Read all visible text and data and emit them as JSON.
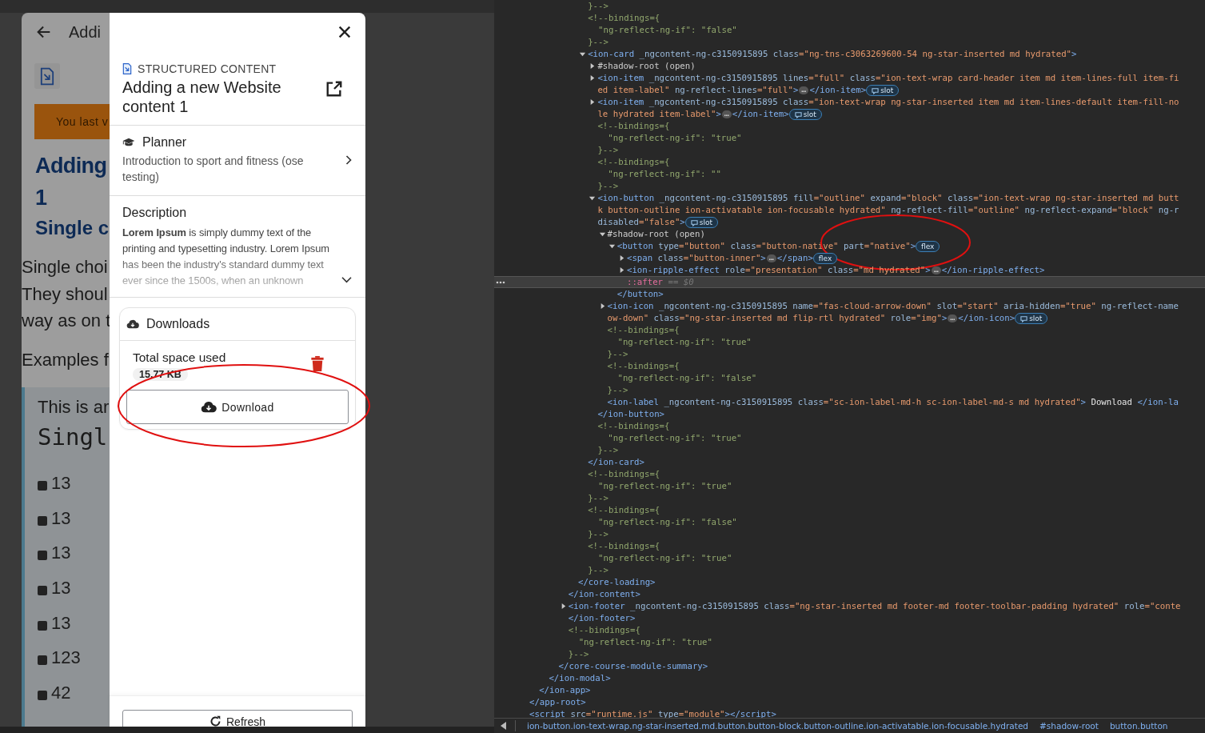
{
  "app": {
    "header_title": "Addi",
    "banner": "You last v",
    "heading_lines": [
      "Adding",
      "1"
    ],
    "subheading": "Single c",
    "paragraph_lines": [
      "Single choi",
      "They shoul",
      "way as on t"
    ],
    "examples": "Examples f",
    "quote": {
      "intro": "This is ar",
      "code": "Singl",
      "items": [
        "13",
        "13",
        "13",
        "13",
        "13",
        "123",
        "42"
      ]
    }
  },
  "modal": {
    "category": "STRUCTURED CONTENT",
    "title": "Adding a new Website content 1",
    "course": {
      "label": "Planner",
      "name": "Introduction to sport and fitness (ose testing)"
    },
    "description": {
      "label": "Description",
      "text": "**Lorem Ipsum** is simply dummy text of the printing and typesetting industry. Lorem Ipsum has been the industry's standard dummy text ever since the 1500s, when an unknown",
      "expanded": false
    },
    "downloads": {
      "title": "Downloads",
      "space_label": "Total space used",
      "space_value": "15.77 KB",
      "button": {
        "label": "Download",
        "circled": true
      }
    },
    "refresh_button": "Refresh"
  },
  "devtools": {
    "dom_tree": [
      {
        "kind": "element",
        "children": [
          {
            "kind": "element",
            "children": [
              {
                "kind": "element",
                "children": [
                  {
                    "kind": "element",
                    "children": [
                      {
                        "kind": "element",
                        "children": [
                          {
                            "kind": "element",
                            "children": [
                              {
                                "kind": "comment",
                                "selected": false,
                                "lines": [
                                  "}-->"
                                ]
                              },
                              {
                                "kind": "comment",
                                "selected": false,
                                "lines": [
                                  "<!--bindings={",
                                  "  \"ng-reflect-ng-if\": \"false\"",
                                  "}-->"
                                ]
                              },
                              {
                                "kind": "element",
                                "expanded": true,
                                "selected": false,
                                "tag": [
                                  {
                                    "kind": "tag",
                                    "text": "<ion-card"
                                  },
                                  {
                                    "kind": "attr",
                                    "text": " _ngcontent-ng-c3150915895 class"
                                  },
                                  {
                                    "kind": "value",
                                    "text": "=\"ng-tns-c3063269600-54 ng-star-inserted md hydrated\""
                                  },
                                  {
                                    "kind": "tag",
                                    "text": ">"
                                  }
                                ],
                                "children": [
                                  {
                                    "kind": "element",
                                    "expanded": false,
                                    "selected": false,
                                    "tag": [
                                      {
                                        "kind": "shadow",
                                        "text": "#shadow-root (open)"
                                      }
                                    ]
                                  },
                                  {
                                    "kind": "element",
                                    "expanded": false,
                                    "selected": false,
                                    "tag": [
                                      {
                                        "kind": "tag",
                                        "text": "<ion-item"
                                      },
                                      {
                                        "kind": "attr",
                                        "text": " _ngcontent-ng-c3150915895 lines"
                                      },
                                      {
                                        "kind": "value",
                                        "text": "=\"full\""
                                      },
                                      {
                                        "kind": "attr",
                                        "text": " class"
                                      },
                                      {
                                        "kind": "value",
                                        "text": "=\"ion-text-wrap card-header item md item-lines-full item-fi\ned item-label\""
                                      },
                                      {
                                        "kind": "attr",
                                        "text": " ng-reflect-lines"
                                      },
                                      {
                                        "kind": "value",
                                        "text": "=\"full\""
                                      },
                                      {
                                        "kind": "tag",
                                        "text": ">"
                                      },
                                      {
                                        "kind": "more",
                                        "text": "…"
                                      },
                                      {
                                        "kind": "tag",
                                        "text": "</ion-item>"
                                      },
                                      {
                                        "kind": "slot-badge",
                                        "text": "slot"
                                      }
                                    ]
                                  },
                                  {
                                    "kind": "element",
                                    "expanded": false,
                                    "selected": false,
                                    "tag": [
                                      {
                                        "kind": "tag",
                                        "text": "<ion-item"
                                      },
                                      {
                                        "kind": "attr",
                                        "text": " _ngcontent-ng-c3150915895 class"
                                      },
                                      {
                                        "kind": "value",
                                        "text": "=\"ion-text-wrap ng-star-inserted item md item-lines-default item-fill-no\nle hydrated item-label\""
                                      },
                                      {
                                        "kind": "tag",
                                        "text": ">"
                                      },
                                      {
                                        "kind": "more",
                                        "text": "…"
                                      },
                                      {
                                        "kind": "tag",
                                        "text": "</ion-item>"
                                      },
                                      {
                                        "kind": "slot-badge",
                                        "text": "slot"
                                      }
                                    ]
                                  },
                                  {
                                    "kind": "comment",
                                    "selected": false,
                                    "lines": [
                                      "<!--bindings={",
                                      "  \"ng-reflect-ng-if\": \"true\"",
                                      "}-->"
                                    ]
                                  },
                                  {
                                    "kind": "comment",
                                    "selected": false,
                                    "lines": [
                                      "<!--bindings={",
                                      "  \"ng-reflect-ng-if\": \"\"",
                                      "}-->"
                                    ]
                                  },
                                  {
                                    "kind": "element",
                                    "expanded": true,
                                    "selected": false,
                                    "tag": [
                                      {
                                        "kind": "tag",
                                        "text": "<ion-button"
                                      },
                                      {
                                        "kind": "attr",
                                        "text": " _ngcontent-ng-c3150915895 fill"
                                      },
                                      {
                                        "kind": "value",
                                        "text": "=\"outline\""
                                      },
                                      {
                                        "kind": "attr",
                                        "text": " expand"
                                      },
                                      {
                                        "kind": "value",
                                        "text": "=\"block\""
                                      },
                                      {
                                        "kind": "attr",
                                        "text": " class"
                                      },
                                      {
                                        "kind": "value",
                                        "text": "=\"ion-text-wrap ng-star-inserted md butt\nk button-outline ion-activatable ion-focusable hydrated\""
                                      },
                                      {
                                        "kind": "attr",
                                        "text": " ng-reflect-fill"
                                      },
                                      {
                                        "kind": "value",
                                        "text": "=\"outline\""
                                      },
                                      {
                                        "kind": "attr",
                                        "text": " ng-reflect-expand"
                                      },
                                      {
                                        "kind": "value",
                                        "text": "=\"block\""
                                      },
                                      {
                                        "kind": "attr",
                                        "text": " ng-r\ndisabled"
                                      },
                                      {
                                        "kind": "value",
                                        "text": "=\"false\""
                                      },
                                      {
                                        "kind": "tag",
                                        "text": ">"
                                      },
                                      {
                                        "kind": "slot-badge",
                                        "text": "slot"
                                      }
                                    ],
                                    "children": [
                                      {
                                        "kind": "element",
                                        "expanded": true,
                                        "selected": false,
                                        "tag": [
                                          {
                                            "kind": "shadow",
                                            "text": "#shadow-root (open)"
                                          }
                                        ],
                                        "children": [
                                          {
                                            "kind": "element",
                                            "expanded": true,
                                            "selected": false,
                                            "circled": true,
                                            "tag": [
                                              {
                                                "kind": "tag",
                                                "text": "<button"
                                              },
                                              {
                                                "kind": "attr",
                                                "text": " type"
                                              },
                                              {
                                                "kind": "value",
                                                "text": "=\"button\""
                                              },
                                              {
                                                "kind": "attr",
                                                "text": " class"
                                              },
                                              {
                                                "kind": "value",
                                                "text": "=\"button-native\""
                                              },
                                              {
                                                "kind": "attr",
                                                "text": " part"
                                              },
                                              {
                                                "kind": "value",
                                                "text": "=\"native\""
                                              },
                                              {
                                                "kind": "tag",
                                                "text": ">"
                                              },
                                              {
                                                "kind": "badge",
                                                "text": "flex"
                                              }
                                            ],
                                            "children": [
                                              {
                                                "kind": "element",
                                                "expanded": false,
                                                "selected": false,
                                                "tag": [
                                                  {
                                                    "kind": "tag",
                                                    "text": "<span"
                                                  },
                                                  {
                                                    "kind": "attr",
                                                    "text": " class"
                                                  },
                                                  {
                                                    "kind": "value",
                                                    "text": "=\"button-inner\""
                                                  },
                                                  {
                                                    "kind": "tag",
                                                    "text": ">"
                                                  },
                                                  {
                                                    "kind": "more",
                                                    "text": "…"
                                                  },
                                                  {
                                                    "kind": "tag",
                                                    "text": "</span>"
                                                  },
                                                  {
                                                    "kind": "badge",
                                                    "text": "flex"
                                                  }
                                                ]
                                              },
                                              {
                                                "kind": "element",
                                                "expanded": false,
                                                "selected": false,
                                                "tag": [
                                                  {
                                                    "kind": "tag",
                                                    "text": "<ion-ripple-effect"
                                                  },
                                                  {
                                                    "kind": "attr",
                                                    "text": " role"
                                                  },
                                                  {
                                                    "kind": "value",
                                                    "text": "=\"presentation\""
                                                  },
                                                  {
                                                    "kind": "attr",
                                                    "text": " class"
                                                  },
                                                  {
                                                    "kind": "value",
                                                    "text": "=\"md hydrated\""
                                                  },
                                                  {
                                                    "kind": "tag",
                                                    "text": ">"
                                                  },
                                                  {
                                                    "kind": "more",
                                                    "text": "…"
                                                  },
                                                  {
                                                    "kind": "tag",
                                                    "text": "</ion-ripple-effect>"
                                                  }
                                                ]
                                              },
                                              {
                                                "kind": "pseudo",
                                                "selected": true,
                                                "text": "::after",
                                                "note": " == $0"
                                              }
                                            ],
                                            "close": [
                                              {
                                                "kind": "tag",
                                                "text": "</button>"
                                              }
                                            ]
                                          }
                                        ]
                                      },
                                      {
                                        "kind": "element",
                                        "expanded": false,
                                        "selected": false,
                                        "tag": [
                                          {
                                            "kind": "tag",
                                            "text": "<ion-icon"
                                          },
                                          {
                                            "kind": "attr",
                                            "text": " _ngcontent-ng-c3150915895 name"
                                          },
                                          {
                                            "kind": "value",
                                            "text": "=\"fas-cloud-arrow-down\""
                                          },
                                          {
                                            "kind": "attr",
                                            "text": " slot"
                                          },
                                          {
                                            "kind": "value",
                                            "text": "=\"start\""
                                          },
                                          {
                                            "kind": "attr",
                                            "text": " aria-hidden"
                                          },
                                          {
                                            "kind": "value",
                                            "text": "=\"true\""
                                          },
                                          {
                                            "kind": "attr",
                                            "text": " ng-reflect-name"
                                          },
                                          {
                                            "kind": "value",
                                            "text": "\now-down\""
                                          },
                                          {
                                            "kind": "attr",
                                            "text": " class"
                                          },
                                          {
                                            "kind": "value",
                                            "text": "=\"ng-star-inserted md flip-rtl hydrated\""
                                          },
                                          {
                                            "kind": "attr",
                                            "text": " role"
                                          },
                                          {
                                            "kind": "value",
                                            "text": "=\"img\""
                                          },
                                          {
                                            "kind": "tag",
                                            "text": ">"
                                          },
                                          {
                                            "kind": "more",
                                            "text": "…"
                                          },
                                          {
                                            "kind": "tag",
                                            "text": "</ion-icon>"
                                          },
                                          {
                                            "kind": "slot-badge",
                                            "text": "slot"
                                          }
                                        ]
                                      },
                                      {
                                        "kind": "comment",
                                        "selected": false,
                                        "lines": [
                                          "<!--bindings={",
                                          "  \"ng-reflect-ng-if\": \"true\"",
                                          "}-->"
                                        ]
                                      },
                                      {
                                        "kind": "comment",
                                        "selected": false,
                                        "lines": [
                                          "<!--bindings={",
                                          "  \"ng-reflect-ng-if\": \"false\"",
                                          "}-->"
                                        ]
                                      },
                                      {
                                        "kind": "element",
                                        "selected": false,
                                        "tag": [
                                          {
                                            "kind": "tag",
                                            "text": "<ion-label"
                                          },
                                          {
                                            "kind": "attr",
                                            "text": " _ngcontent-ng-c3150915895 class"
                                          },
                                          {
                                            "kind": "value",
                                            "text": "=\"sc-ion-label-md-h sc-ion-label-md-s md hydrated\""
                                          },
                                          {
                                            "kind": "tag",
                                            "text": ">"
                                          },
                                          {
                                            "kind": "text",
                                            "text": " Download "
                                          },
                                          {
                                            "kind": "tag",
                                            "text": "</ion-la"
                                          }
                                        ]
                                      }
                                    ],
                                    "close": [
                                      {
                                        "kind": "tag",
                                        "text": "</ion-button>"
                                      }
                                    ]
                                  },
                                  {
                                    "kind": "comment",
                                    "selected": false,
                                    "lines": [
                                      "<!--bindings={",
                                      "  \"ng-reflect-ng-if\": \"true\"",
                                      "}-->"
                                    ]
                                  }
                                ],
                                "close": [
                                  {
                                    "kind": "tag",
                                    "text": "</ion-card>"
                                  }
                                ]
                              },
                              {
                                "kind": "comment",
                                "selected": false,
                                "lines": [
                                  "<!--bindings={",
                                  "  \"ng-reflect-ng-if\": \"true\"",
                                  "}-->"
                                ]
                              },
                              {
                                "kind": "comment",
                                "selected": false,
                                "lines": [
                                  "<!--bindings={",
                                  "  \"ng-reflect-ng-if\": \"false\"",
                                  "}-->"
                                ]
                              },
                              {
                                "kind": "comment",
                                "selected": false,
                                "lines": [
                                  "<!--bindings={",
                                  "  \"ng-reflect-ng-if\": \"true\"",
                                  "}-->"
                                ]
                              }
                            ],
                            "close": [
                              {
                                "kind": "tag",
                                "text": "</core-loading>"
                              }
                            ]
                          }
                        ],
                        "close": [
                          {
                            "kind": "tag",
                            "text": "</ion-content>"
                          }
                        ]
                      },
                      {
                        "kind": "element",
                        "expanded": false,
                        "selected": false,
                        "tag": [
                          {
                            "kind": "tag",
                            "text": "<ion-footer"
                          },
                          {
                            "kind": "attr",
                            "text": " _ngcontent-ng-c3150915895 class"
                          },
                          {
                            "kind": "value",
                            "text": "=\"ng-star-inserted md footer-md footer-toolbar-padding hydrated\""
                          },
                          {
                            "kind": "attr",
                            "text": " role"
                          },
                          {
                            "kind": "value",
                            "text": "=\"conte"
                          }
                        ],
                        "close": [
                          {
                            "kind": "tag",
                            "text": "</ion-footer>"
                          }
                        ]
                      },
                      {
                        "kind": "comment",
                        "selected": false,
                        "lines": [
                          "<!--bindings={",
                          "  \"ng-reflect-ng-if\": \"true\"",
                          "}-->"
                        ]
                      }
                    ],
                    "close": [
                      {
                        "kind": "tag",
                        "text": "</core-course-module-summary>"
                      }
                    ]
                  }
                ],
                "close": [
                  {
                    "kind": "tag",
                    "text": "</ion-modal>"
                  }
                ]
              }
            ],
            "close": [
              {
                "kind": "tag",
                "text": "</ion-app>"
              }
            ]
          }
        ],
        "close": [
          {
            "kind": "tag",
            "text": "</app-root>"
          }
        ]
      },
      {
        "kind": "element",
        "selected": false,
        "tag": [
          {
            "kind": "tag",
            "text": "<script"
          },
          {
            "kind": "attr",
            "text": " src"
          },
          {
            "kind": "value",
            "text": "=\"runtime.js\""
          },
          {
            "kind": "attr",
            "text": " type"
          },
          {
            "kind": "value",
            "text": "=\"module\""
          },
          {
            "kind": "tag",
            "text": "></script>"
          }
        ]
      }
    ],
    "breadcrumbs": [
      "ion-button.ion-text-wrap.ng-star-inserted.md.button.button-block.button-outline.ion-activatable.ion-focusable.hydrated",
      "#shadow-root",
      "button.button"
    ]
  }
}
